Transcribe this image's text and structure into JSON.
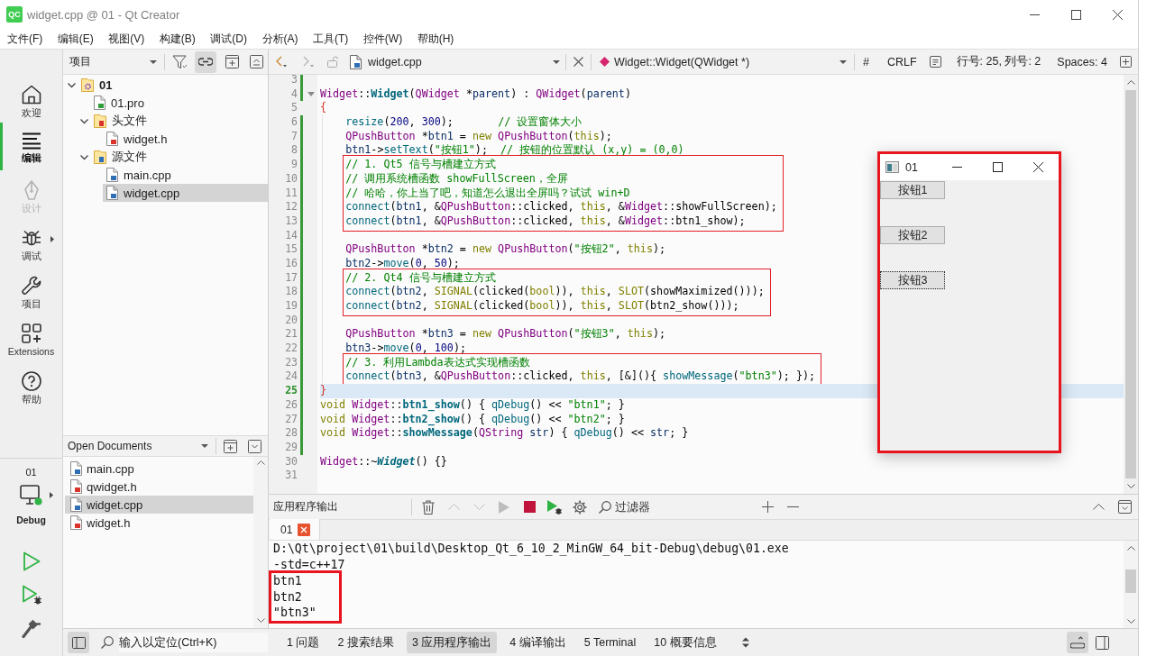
{
  "window": {
    "logo": "QC",
    "title": "widget.cpp @ 01 - Qt Creator"
  },
  "menu": [
    "文件(F)",
    "编辑(E)",
    "视图(V)",
    "构建(B)",
    "调试(D)",
    "分析(A)",
    "工具(T)",
    "控件(W)",
    "帮助(H)"
  ],
  "modes": [
    {
      "kind": "welcome",
      "label": "欢迎",
      "selected": false,
      "disabled": false,
      "has_menu": false
    },
    {
      "kind": "edit",
      "label": "编辑",
      "selected": true,
      "disabled": false,
      "has_menu": false
    },
    {
      "kind": "design",
      "label": "设计",
      "selected": false,
      "disabled": true,
      "has_menu": false
    },
    {
      "kind": "debug",
      "label": "调试",
      "selected": false,
      "disabled": false,
      "has_menu": true
    },
    {
      "kind": "projects",
      "label": "项目",
      "selected": false,
      "disabled": false,
      "has_menu": false
    },
    {
      "kind": "extensions",
      "label": "Extensions",
      "selected": false,
      "disabled": false,
      "has_menu": false
    },
    {
      "kind": "help",
      "label": "帮助",
      "selected": false,
      "disabled": false,
      "has_menu": false
    }
  ],
  "run_target": {
    "project": "01",
    "config": "Debug"
  },
  "project_panel": {
    "title": "项目",
    "sync_on": true,
    "tree": [
      {
        "kind": "project",
        "label": "01",
        "expanded": true,
        "selected": false,
        "children": [
          {
            "kind": "profile",
            "label": "01.pro",
            "selected": false
          },
          {
            "kind": "headers",
            "label": "头文件",
            "expanded": true,
            "selected": false,
            "children": [
              {
                "kind": "header",
                "label": "widget.h",
                "selected": false
              }
            ]
          },
          {
            "kind": "sources",
            "label": "源文件",
            "expanded": true,
            "selected": false,
            "children": [
              {
                "kind": "source",
                "label": "main.cpp",
                "selected": false
              },
              {
                "kind": "source",
                "label": "widget.cpp",
                "selected": true
              }
            ]
          }
        ]
      }
    ]
  },
  "open_documents": {
    "title": "Open Documents",
    "items": [
      {
        "kind": "source",
        "label": "main.cpp",
        "selected": false
      },
      {
        "kind": "header",
        "label": "qwidget.h",
        "selected": false
      },
      {
        "kind": "source",
        "label": "widget.cpp",
        "selected": true
      },
      {
        "kind": "header",
        "label": "widget.h",
        "selected": false
      }
    ]
  },
  "editor": {
    "toolbar": {
      "back_disabled": false,
      "forward_disabled": true,
      "file": "widget.cpp",
      "symbol": "Widget::Widget(QWidget *)",
      "hash": "#",
      "line_ending": "CRLF",
      "cursor": "行号: 25, 列号: 2",
      "indentation": "Spaces: 4"
    },
    "blocks": [
      {
        "indented": false,
        "boxed": false,
        "lines": [
          {
            "number": "3",
            "changed": true,
            "current": false
          },
          {
            "number": "4",
            "changed": true,
            "current": false,
            "expanded": true,
            "tokens": [
              {
                "kind": "type",
                "text": "Widget"
              },
              {
                "kind": "plain",
                "text": "::"
              },
              {
                "kind": "funcdef",
                "text": "Widget"
              },
              {
                "kind": "plain",
                "text": "("
              },
              {
                "kind": "type",
                "text": "QWidget"
              },
              {
                "kind": "plain",
                "text": " *"
              },
              {
                "kind": "param",
                "text": "parent"
              },
              {
                "kind": "plain",
                "text": ") : "
              },
              {
                "kind": "type",
                "text": "QWidget"
              },
              {
                "kind": "plain",
                "text": "("
              },
              {
                "kind": "param",
                "text": "parent"
              },
              {
                "kind": "plain",
                "text": ")"
              }
            ]
          },
          {
            "number": "5",
            "changed": false,
            "current": false,
            "tokens": [
              {
                "kind": "brace",
                "text": "{"
              }
            ]
          }
        ]
      },
      {
        "indented": true,
        "boxed": false,
        "lines": [
          {
            "number": "6",
            "changed": true,
            "current": false,
            "tokens": [
              {
                "kind": "func",
                "text": "resize"
              },
              {
                "kind": "plain",
                "text": "("
              },
              {
                "kind": "number",
                "text": "200"
              },
              {
                "kind": "plain",
                "text": ", "
              },
              {
                "kind": "number",
                "text": "300"
              },
              {
                "kind": "plain",
                "text": ");       "
              },
              {
                "kind": "comment",
                "text": "// 设置窗体大小"
              }
            ]
          },
          {
            "number": "7",
            "changed": true,
            "current": false,
            "tokens": [
              {
                "kind": "type",
                "text": "QPushButton"
              },
              {
                "kind": "plain",
                "text": " *"
              },
              {
                "kind": "local",
                "text": "btn1"
              },
              {
                "kind": "plain",
                "text": " = "
              },
              {
                "kind": "keyword",
                "text": "new "
              },
              {
                "kind": "type",
                "text": "QPushButton"
              },
              {
                "kind": "plain",
                "text": "("
              },
              {
                "kind": "keyword",
                "text": "this"
              },
              {
                "kind": "plain",
                "text": ");"
              }
            ]
          },
          {
            "number": "8",
            "changed": true,
            "current": false,
            "tokens": [
              {
                "kind": "local",
                "text": "btn1"
              },
              {
                "kind": "plain",
                "text": "->"
              },
              {
                "kind": "func",
                "text": "setText"
              },
              {
                "kind": "plain",
                "text": "("
              },
              {
                "kind": "string",
                "text": "\"按钮1\""
              },
              {
                "kind": "plain",
                "text": ");  "
              },
              {
                "kind": "comment",
                "text": "// 按钮的位置默认 (x,y) = (0,0)"
              }
            ]
          }
        ]
      },
      {
        "indented": true,
        "boxed": true,
        "lines": [
          {
            "number": "9",
            "changed": true,
            "current": false,
            "tokens": [
              {
                "kind": "comment",
                "text": "// 1. Qt5 信号与槽建立方式"
              }
            ]
          },
          {
            "number": "10",
            "changed": true,
            "current": false,
            "tokens": [
              {
                "kind": "comment",
                "text": "// 调用系统槽函数 showFullScreen，全屏"
              }
            ]
          },
          {
            "number": "11",
            "changed": true,
            "current": false,
            "tokens": [
              {
                "kind": "comment",
                "text": "// 哈哈，你上当了吧，知道怎么退出全屏吗？试试 win+D"
              }
            ]
          },
          {
            "number": "12",
            "changed": true,
            "current": false,
            "tokens": [
              {
                "kind": "func",
                "text": "connect"
              },
              {
                "kind": "plain",
                "text": "("
              },
              {
                "kind": "local",
                "text": "btn1"
              },
              {
                "kind": "plain",
                "text": ", &"
              },
              {
                "kind": "type",
                "text": "QPushButton"
              },
              {
                "kind": "plain",
                "text": "::clicked, "
              },
              {
                "kind": "keyword",
                "text": "this"
              },
              {
                "kind": "plain",
                "text": ", &"
              },
              {
                "kind": "type",
                "text": "Widget"
              },
              {
                "kind": "plain",
                "text": "::showFullScreen);"
              }
            ]
          },
          {
            "number": "13",
            "changed": true,
            "current": false,
            "tokens": [
              {
                "kind": "func",
                "text": "connect"
              },
              {
                "kind": "plain",
                "text": "("
              },
              {
                "kind": "local",
                "text": "btn1"
              },
              {
                "kind": "plain",
                "text": ", &"
              },
              {
                "kind": "type",
                "text": "QPushButton"
              },
              {
                "kind": "plain",
                "text": "::clicked, "
              },
              {
                "kind": "keyword",
                "text": "this"
              },
              {
                "kind": "plain",
                "text": ", &"
              },
              {
                "kind": "type",
                "text": "Widget"
              },
              {
                "kind": "plain",
                "text": "::btn1_show);"
              }
            ]
          }
        ]
      },
      {
        "indented": true,
        "boxed": false,
        "lines": [
          {
            "number": "14",
            "changed": true,
            "current": false
          },
          {
            "number": "15",
            "changed": true,
            "current": false,
            "tokens": [
              {
                "kind": "type",
                "text": "QPushButton"
              },
              {
                "kind": "plain",
                "text": " *"
              },
              {
                "kind": "local",
                "text": "btn2"
              },
              {
                "kind": "plain",
                "text": " = "
              },
              {
                "kind": "keyword",
                "text": "new "
              },
              {
                "kind": "type",
                "text": "QPushButton"
              },
              {
                "kind": "plain",
                "text": "("
              },
              {
                "kind": "string",
                "text": "\"按钮2\""
              },
              {
                "kind": "plain",
                "text": ", "
              },
              {
                "kind": "keyword",
                "text": "this"
              },
              {
                "kind": "plain",
                "text": ");"
              }
            ]
          },
          {
            "number": "16",
            "changed": true,
            "current": false,
            "tokens": [
              {
                "kind": "local",
                "text": "btn2"
              },
              {
                "kind": "plain",
                "text": "->"
              },
              {
                "kind": "func",
                "text": "move"
              },
              {
                "kind": "plain",
                "text": "("
              },
              {
                "kind": "number",
                "text": "0"
              },
              {
                "kind": "plain",
                "text": ", "
              },
              {
                "kind": "number",
                "text": "50"
              },
              {
                "kind": "plain",
                "text": ");"
              }
            ]
          }
        ]
      },
      {
        "indented": true,
        "boxed": true,
        "lines": [
          {
            "number": "17",
            "changed": true,
            "current": false,
            "tokens": [
              {
                "kind": "comment",
                "text": "// 2. Qt4 信号与槽建立方式"
              }
            ]
          },
          {
            "number": "18",
            "changed": true,
            "current": false,
            "tokens": [
              {
                "kind": "func",
                "text": "connect"
              },
              {
                "kind": "plain",
                "text": "("
              },
              {
                "kind": "local",
                "text": "btn2"
              },
              {
                "kind": "plain",
                "text": ", "
              },
              {
                "kind": "keyword",
                "text": "SIGNAL"
              },
              {
                "kind": "plain",
                "text": "(clicked("
              },
              {
                "kind": "keyword",
                "text": "bool"
              },
              {
                "kind": "plain",
                "text": ")), "
              },
              {
                "kind": "keyword",
                "text": "this"
              },
              {
                "kind": "plain",
                "text": ", "
              },
              {
                "kind": "keyword",
                "text": "SLOT"
              },
              {
                "kind": "plain",
                "text": "(showMaximized()));"
              }
            ]
          },
          {
            "number": "19",
            "changed": true,
            "current": false,
            "tokens": [
              {
                "kind": "func",
                "text": "connect"
              },
              {
                "kind": "plain",
                "text": "("
              },
              {
                "kind": "local",
                "text": "btn2"
              },
              {
                "kind": "plain",
                "text": ", "
              },
              {
                "kind": "keyword",
                "text": "SIGNAL"
              },
              {
                "kind": "plain",
                "text": "(clicked("
              },
              {
                "kind": "keyword",
                "text": "bool"
              },
              {
                "kind": "plain",
                "text": ")), "
              },
              {
                "kind": "keyword",
                "text": "this"
              },
              {
                "kind": "plain",
                "text": ", "
              },
              {
                "kind": "keyword",
                "text": "SLOT"
              },
              {
                "kind": "plain",
                "text": "(btn2_show()));"
              }
            ]
          }
        ]
      },
      {
        "indented": true,
        "boxed": false,
        "lines": [
          {
            "number": "20",
            "changed": true,
            "current": false
          },
          {
            "number": "21",
            "changed": true,
            "current": false,
            "tokens": [
              {
                "kind": "type",
                "text": "QPushButton"
              },
              {
                "kind": "plain",
                "text": " *"
              },
              {
                "kind": "local",
                "text": "btn3"
              },
              {
                "kind": "plain",
                "text": " = "
              },
              {
                "kind": "keyword",
                "text": "new "
              },
              {
                "kind": "type",
                "text": "QPushButton"
              },
              {
                "kind": "plain",
                "text": "("
              },
              {
                "kind": "string",
                "text": "\"按钮3\""
              },
              {
                "kind": "plain",
                "text": ", "
              },
              {
                "kind": "keyword",
                "text": "this"
              },
              {
                "kind": "plain",
                "text": ");"
              }
            ]
          },
          {
            "number": "22",
            "changed": true,
            "current": false,
            "tokens": [
              {
                "kind": "local",
                "text": "btn3"
              },
              {
                "kind": "plain",
                "text": "->"
              },
              {
                "kind": "func",
                "text": "move"
              },
              {
                "kind": "plain",
                "text": "("
              },
              {
                "kind": "number",
                "text": "0"
              },
              {
                "kind": "plain",
                "text": ", "
              },
              {
                "kind": "number",
                "text": "100"
              },
              {
                "kind": "plain",
                "text": ");"
              }
            ]
          }
        ]
      },
      {
        "indented": true,
        "boxed": true,
        "lines": [
          {
            "number": "23",
            "changed": true,
            "current": false,
            "tokens": [
              {
                "kind": "comment",
                "text": "// 3. 利用Lambda表达式实现槽函数"
              }
            ]
          },
          {
            "number": "24",
            "changed": true,
            "current": false,
            "tokens": [
              {
                "kind": "func",
                "text": "connect"
              },
              {
                "kind": "plain",
                "text": "("
              },
              {
                "kind": "local",
                "text": "btn3"
              },
              {
                "kind": "plain",
                "text": ", &"
              },
              {
                "kind": "type",
                "text": "QPushButton"
              },
              {
                "kind": "plain",
                "text": "::clicked, "
              },
              {
                "kind": "keyword",
                "text": "this"
              },
              {
                "kind": "plain",
                "text": ", [&](){ "
              },
              {
                "kind": "func",
                "text": "showMessage"
              },
              {
                "kind": "plain",
                "text": "("
              },
              {
                "kind": "string",
                "text": "\"btn3\""
              },
              {
                "kind": "plain",
                "text": "); });"
              }
            ]
          }
        ]
      },
      {
        "indented": false,
        "boxed": false,
        "lines": [
          {
            "number": "25",
            "changed": true,
            "current": true,
            "tokens": [
              {
                "kind": "brace",
                "text": "}"
              }
            ]
          },
          {
            "number": "26",
            "changed": true,
            "current": false,
            "tokens": [
              {
                "kind": "keyword",
                "text": "void "
              },
              {
                "kind": "type",
                "text": "Widget"
              },
              {
                "kind": "plain",
                "text": "::"
              },
              {
                "kind": "funcdef",
                "text": "btn1_show"
              },
              {
                "kind": "plain",
                "text": "() { "
              },
              {
                "kind": "func",
                "text": "qDebug"
              },
              {
                "kind": "plain",
                "text": "() << "
              },
              {
                "kind": "string",
                "text": "\"btn1\""
              },
              {
                "kind": "plain",
                "text": "; }"
              }
            ]
          },
          {
            "number": "27",
            "changed": true,
            "current": false,
            "tokens": [
              {
                "kind": "keyword",
                "text": "void "
              },
              {
                "kind": "type",
                "text": "Widget"
              },
              {
                "kind": "plain",
                "text": "::"
              },
              {
                "kind": "funcdef",
                "text": "btn2_show"
              },
              {
                "kind": "plain",
                "text": "() { "
              },
              {
                "kind": "func",
                "text": "qDebug"
              },
              {
                "kind": "plain",
                "text": "() << "
              },
              {
                "kind": "string",
                "text": "\"btn2\""
              },
              {
                "kind": "plain",
                "text": "; }"
              }
            ]
          },
          {
            "number": "28",
            "changed": true,
            "current": false,
            "tokens": [
              {
                "kind": "keyword",
                "text": "void "
              },
              {
                "kind": "type",
                "text": "Widget"
              },
              {
                "kind": "plain",
                "text": "::"
              },
              {
                "kind": "funcdef",
                "text": "showMessage"
              },
              {
                "kind": "plain",
                "text": "("
              },
              {
                "kind": "type",
                "text": "QString "
              },
              {
                "kind": "param",
                "text": "str"
              },
              {
                "kind": "plain",
                "text": ") { "
              },
              {
                "kind": "func",
                "text": "qDebug"
              },
              {
                "kind": "plain",
                "text": "() << "
              },
              {
                "kind": "param",
                "text": "str"
              },
              {
                "kind": "plain",
                "text": "; }"
              }
            ]
          },
          {
            "number": "29",
            "changed": true,
            "current": false
          },
          {
            "number": "30",
            "changed": false,
            "current": false,
            "tokens": [
              {
                "kind": "type",
                "text": "Widget"
              },
              {
                "kind": "plain",
                "text": "::~"
              },
              {
                "kind": "virtual",
                "text": "Widget"
              },
              {
                "kind": "plain",
                "text": "() {}"
              }
            ]
          },
          {
            "number": "31",
            "changed": false,
            "current": false
          }
        ]
      }
    ]
  },
  "output": {
    "title": "应用程序输出",
    "tools": [
      {
        "kind": "clear",
        "disabled": false
      },
      {
        "kind": "up",
        "disabled": true
      },
      {
        "kind": "down",
        "disabled": true
      },
      {
        "kind": "rerun",
        "disabled": true
      },
      {
        "kind": "stop",
        "disabled": false
      },
      {
        "kind": "debug",
        "disabled": false
      },
      {
        "kind": "settings",
        "disabled": false
      }
    ],
    "filter": {
      "placeholder": "过滤器"
    },
    "tabs": [
      {
        "label": "01",
        "selected": true
      }
    ],
    "blocks": [
      {
        "boxed": false,
        "lines": [
          "D:\\Qt\\project\\01\\build\\Desktop_Qt_6_10_2_MinGW_64_bit-Debug\\debug\\01.exe",
          "-std=c++17"
        ]
      },
      {
        "boxed": true,
        "lines": [
          "btn1",
          "btn2",
          "\"btn3\""
        ]
      }
    ]
  },
  "status_bar": {
    "sidebar_on": true,
    "locate": {
      "placeholder": "输入以定位(Ctrl+K)"
    },
    "panes": [
      {
        "label": "1 问题",
        "selected": false
      },
      {
        "label": "2 搜索结果",
        "selected": false
      },
      {
        "label": "3 应用程序输出",
        "selected": true
      },
      {
        "label": "4 编译输出",
        "selected": false
      },
      {
        "label": "5 Terminal",
        "selected": false
      },
      {
        "label": "10 概要信息",
        "selected": false
      }
    ],
    "output_on": true
  },
  "app_window": {
    "title": "01",
    "boxed": true,
    "buttons": [
      {
        "label": "按钮1",
        "focused": false
      },
      {
        "label": "按钮2",
        "focused": false
      },
      {
        "label": "按钮3",
        "focused": true
      }
    ]
  }
}
